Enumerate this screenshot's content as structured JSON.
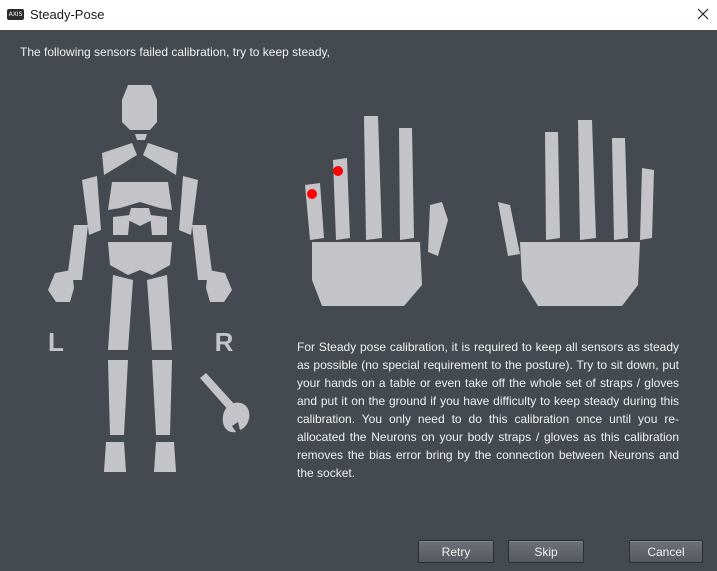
{
  "window": {
    "app_icon_text": "AXIS",
    "title": "Steady-Pose"
  },
  "main": {
    "message": "The following sensors failed calibration, try to keep steady,",
    "left_label": "L",
    "right_label": "R",
    "description": "For Steady pose calibration, it is required to keep all sensors as steady as possible (no special requirement to the posture). Try to sit down, put your hands on a table or even take off the whole set of straps / gloves and put it on the ground if you have difficulty to keep steady during this calibration. You only need to do this calibration once until you re-allocated the Neurons on your body straps / gloves as this calibration removes the bias error bring by the connection between Neurons and the socket."
  },
  "buttons": {
    "retry": "Retry",
    "skip": "Skip",
    "cancel": "Cancel"
  },
  "colors": {
    "background": "#454a51",
    "silhouette": "#c4c4c8",
    "failed_sensor": "#ff0000"
  }
}
